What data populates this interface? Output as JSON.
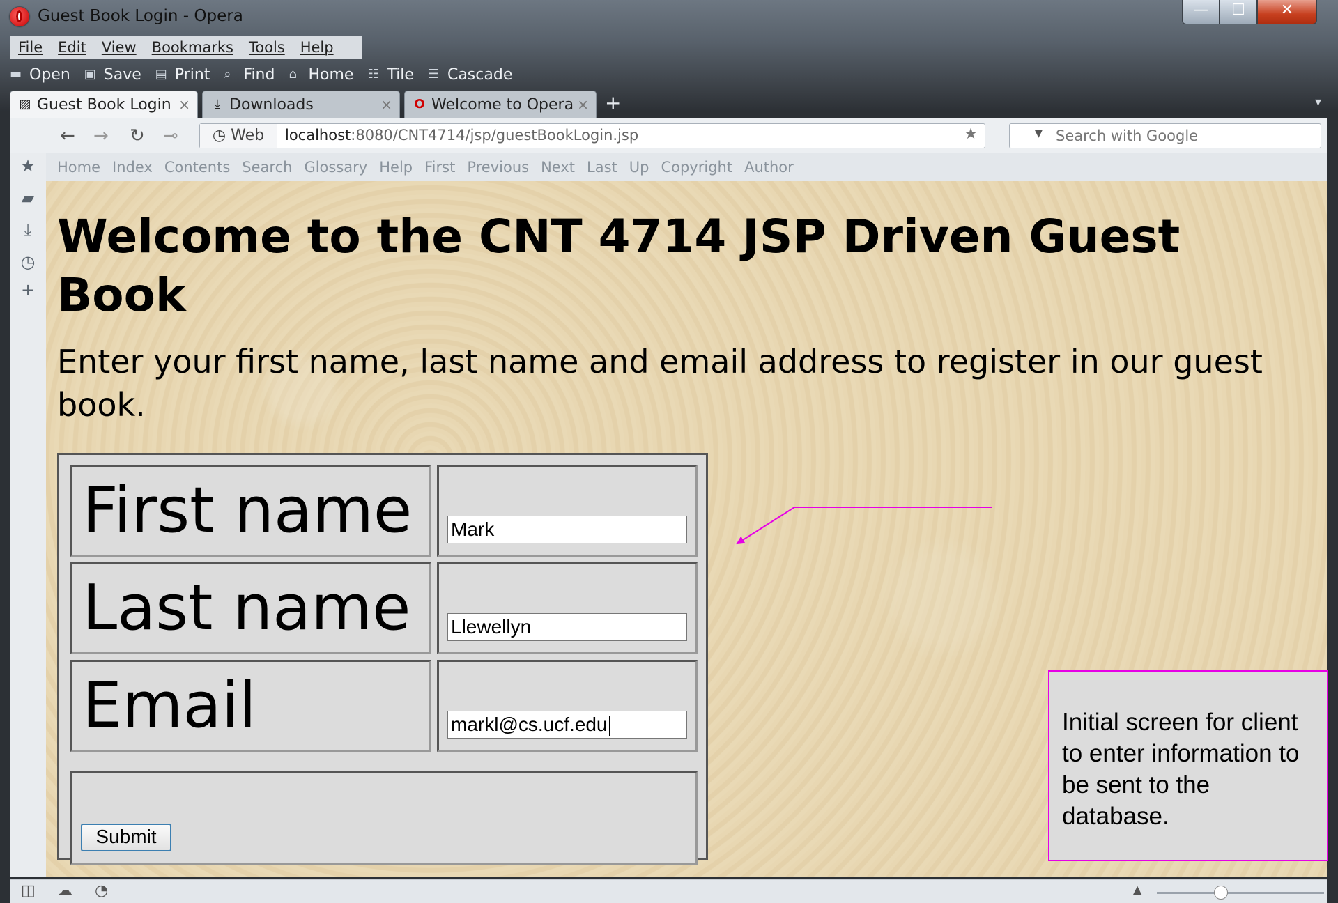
{
  "window": {
    "title": "Guest Book Login - Opera",
    "controls": {
      "minimize": "—",
      "maximize": "☐",
      "close": "✕"
    }
  },
  "menu": [
    "File",
    "Edit",
    "View",
    "Bookmarks",
    "Tools",
    "Help"
  ],
  "toolbar": [
    "Open",
    "Save",
    "Print",
    "Find",
    "Home",
    "Tile",
    "Cascade"
  ],
  "tabs": [
    {
      "label": "Guest Book Login",
      "active": true
    },
    {
      "label": "Downloads",
      "active": false
    },
    {
      "label": "Welcome to Opera",
      "active": false
    }
  ],
  "address": {
    "web_label": "Web",
    "url_host": "localhost",
    "url_rest": ":8080/CNT4714/jsp/guestBookLogin.jsp",
    "search_placeholder": "Search with Google"
  },
  "nav_links": [
    "Home",
    "Index",
    "Contents",
    "Search",
    "Glossary",
    "Help",
    "First",
    "Previous",
    "Next",
    "Last",
    "Up",
    "Copyright",
    "Author"
  ],
  "page": {
    "title": "Welcome to the CNT 4714 JSP Driven Guest Book",
    "intro": "Enter your first name, last name and email address to register in our guest book.",
    "form": {
      "first_label": "First name",
      "first_value": "Mark",
      "last_label": "Last name",
      "last_value": "Llewellyn",
      "email_label": "Email",
      "email_value": "markl@cs.ucf.edu",
      "submit_label": "Submit"
    }
  },
  "annotation": {
    "text": "Initial screen for client to enter information to be sent to the database.",
    "color": "#e600e6"
  },
  "icons": {
    "sidebar": [
      "bookmarks-icon",
      "notes-icon",
      "downloads-icon",
      "history-icon",
      "add-panel-icon"
    ]
  }
}
